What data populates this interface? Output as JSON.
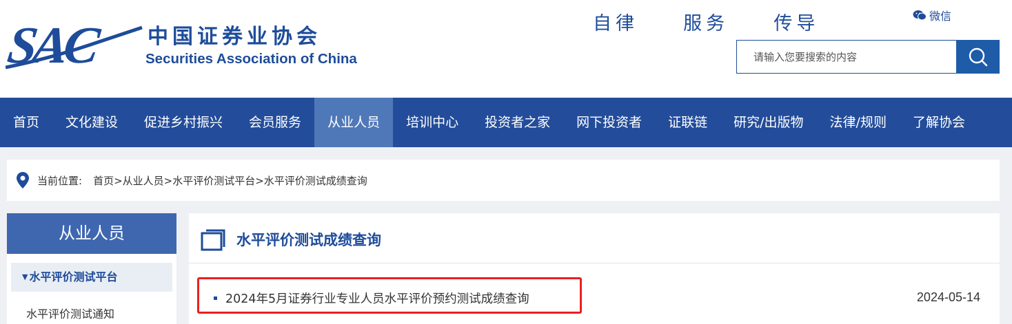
{
  "header": {
    "logo_mark": "SAC",
    "logo_cn": "中国证券业协会",
    "logo_en": "Securities Association of China",
    "slogan": "自律  服务  传导",
    "wechat_label": "微信",
    "search_placeholder": "请输入您要搜索的内容"
  },
  "nav": {
    "items": [
      {
        "label": "首页"
      },
      {
        "label": "文化建设"
      },
      {
        "label": "促进乡村振兴"
      },
      {
        "label": "会员服务"
      },
      {
        "label": "从业人员"
      },
      {
        "label": "培训中心"
      },
      {
        "label": "投资者之家"
      },
      {
        "label": "网下投资者"
      },
      {
        "label": "证联链"
      },
      {
        "label": "研究/出版物"
      },
      {
        "label": "法律/规则"
      },
      {
        "label": "了解协会"
      }
    ],
    "active_index": 4
  },
  "breadcrumb": {
    "label": "当前位置:",
    "path": "首页>从业人员>水平评价测试平台>水平评价测试成绩查询"
  },
  "sidebar": {
    "title": "从业人员",
    "active_item": "水平评价测试平台",
    "items": [
      {
        "label": "水平评价测试通知"
      }
    ]
  },
  "main": {
    "title": "水平评价测试成绩查询",
    "list": [
      {
        "title": "2024年5月证券行业专业人员水平评价预约测试成绩查询",
        "date": "2024-05-14"
      }
    ]
  },
  "colors": {
    "brand_blue": "#1e4c9a",
    "nav_bg": "#234d9b",
    "nav_active": "#4f78b8",
    "highlight_red": "#e82020"
  }
}
